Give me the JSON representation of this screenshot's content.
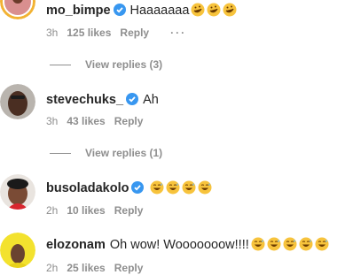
{
  "comments": [
    {
      "username": "mo_bimpe",
      "text": "Haaaaaaa",
      "emoji_count": 3,
      "emoji_icon": "rofl-emoji-icon",
      "time": "3h",
      "likes": "125 likes",
      "reply": "Reply",
      "more": "···",
      "view_replies": "View replies (3)"
    },
    {
      "username": "stevechuks_",
      "text": "Ah",
      "emoji_count": 0,
      "time": "3h",
      "likes": "43 likes",
      "reply": "Reply",
      "view_replies": "View replies (1)"
    },
    {
      "username": "busoladakolo",
      "text": "",
      "emoji_count": 4,
      "emoji_icon": "grinning-sweat-emoji-icon",
      "time": "2h",
      "likes": "10 likes",
      "reply": "Reply"
    },
    {
      "username": "elozonam",
      "text": "Oh wow! Wooooooow!!!!",
      "emoji_count": 5,
      "emoji_icon": "grinning-sweat-emoji-icon",
      "time": "2h",
      "likes": "25 likes",
      "reply": "Reply"
    }
  ],
  "colors": {
    "verified": "#3897f0",
    "meta": "#8e8e8e",
    "text": "#262626",
    "emoji": "#f7c33c"
  }
}
